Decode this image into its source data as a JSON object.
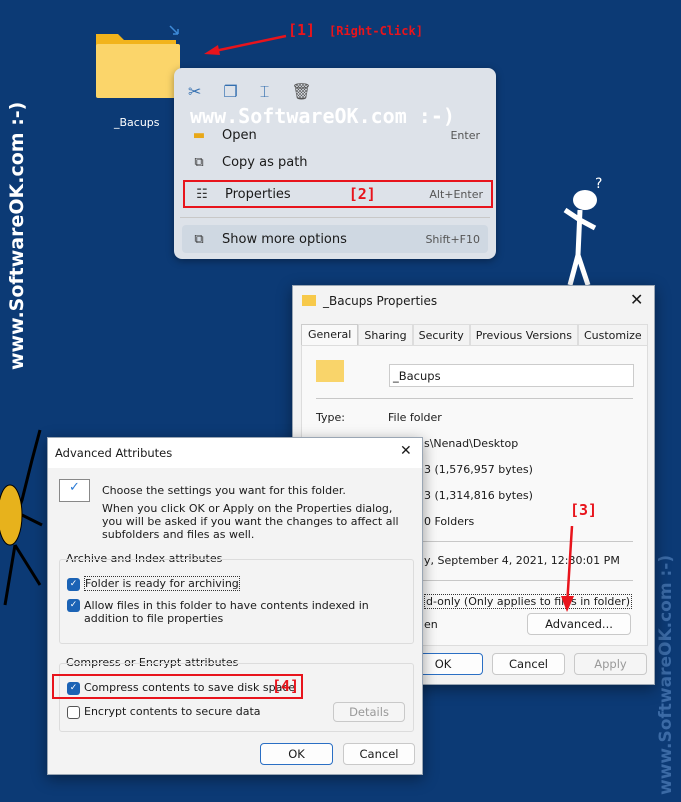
{
  "watermark_left": "www.SoftwareOK.com :-)",
  "watermark_right": "www.SoftwareOK.com :-)",
  "watermark_menu": "www.SoftwareOK.com :-)",
  "desktop": {
    "folder_label": "_Bacups"
  },
  "annotations": {
    "step1": "[1]",
    "right_click": "[Right-Click]",
    "step2": "[2]",
    "step3": "[3]",
    "step4": "[4]",
    "accent": "#e8141c"
  },
  "context_menu": {
    "toolbar_icons": [
      "cut-icon",
      "copy-icon",
      "rename-icon",
      "delete-icon"
    ],
    "items": [
      {
        "label": "Open",
        "shortcut": "Enter",
        "icon": "folder-open-icon"
      },
      {
        "label": "Copy as path",
        "shortcut": "",
        "icon": "copy-path-icon"
      },
      {
        "label": "Properties",
        "shortcut": "Alt+Enter",
        "icon": "properties-icon"
      },
      {
        "label": "Show more options",
        "shortcut": "Shift+F10",
        "icon": "more-options-icon"
      }
    ]
  },
  "properties": {
    "title": "_Bacups Properties",
    "tabs": [
      "General",
      "Sharing",
      "Security",
      "Previous Versions",
      "Customize"
    ],
    "name_value": "_Bacups",
    "type_label": "Type:",
    "type_value": "File folder",
    "location_partial": "s\\Nenad\\Desktop",
    "size_partial": "3 (1,576,957 bytes)",
    "size_disk_partial": "3 (1,314,816 bytes)",
    "contains_partial": "0 Folders",
    "created_partial": "y, September 4, 2021, 12:30:01 PM",
    "readonly_partial": "d-only (Only applies to files in folder)",
    "hidden_partial": "en",
    "advanced_button": "Advanced...",
    "ok": "OK",
    "cancel": "Cancel",
    "apply": "Apply"
  },
  "advanced": {
    "title": "Advanced Attributes",
    "intro1": "Choose the settings you want for this folder.",
    "intro2": "When you click OK or Apply on the Properties dialog, you will be asked if you want the changes to affect all subfolders and files as well.",
    "group1": "Archive and Index attributes",
    "archive": "Folder is ready for archiving",
    "archive_checked": true,
    "index": "Allow files in this folder to have contents indexed in addition to file properties",
    "index_checked": true,
    "group2": "Compress or Encrypt attributes",
    "compress": "Compress contents to save disk space",
    "compress_checked": true,
    "encrypt": "Encrypt contents to secure data",
    "encrypt_checked": false,
    "details": "Details",
    "ok": "OK",
    "cancel": "Cancel"
  }
}
